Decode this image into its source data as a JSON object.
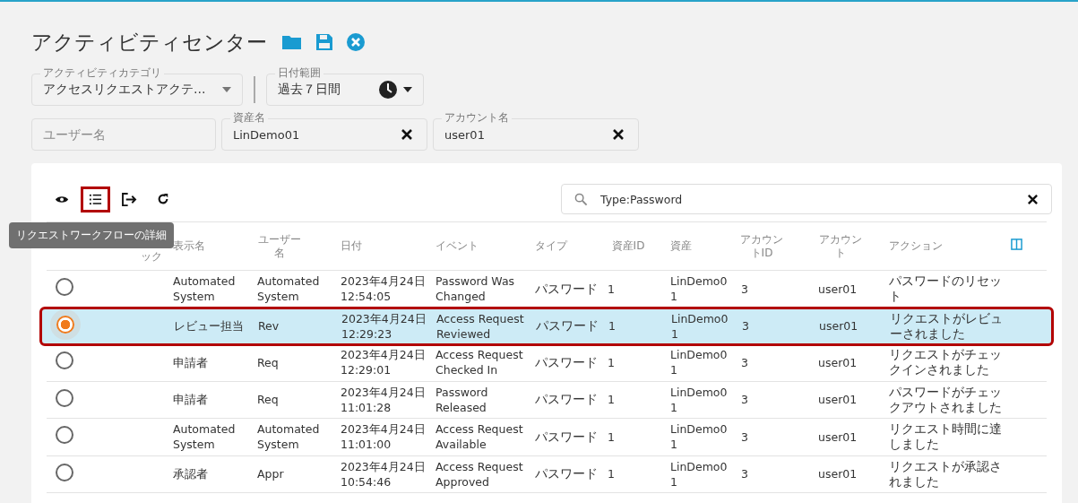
{
  "title": "アクティビティセンター",
  "filters": [
    {
      "kind": "select",
      "label": "アクティビティカテゴリ",
      "value": "アクセスリクエストアクテ…"
    },
    {
      "kind": "date",
      "label": "日付範囲",
      "value": "過去７日間"
    }
  ],
  "fields": [
    {
      "placeholder": "ユーザー名"
    },
    {
      "label": "資産名",
      "value": "LinDemo01"
    },
    {
      "label": "アカウント名",
      "value": "user01"
    }
  ],
  "toolbar": [
    {
      "kind": "eye",
      "highlighted": false
    },
    {
      "kind": "list",
      "highlighted": true
    },
    {
      "kind": "export",
      "highlighted": false
    },
    {
      "kind": "refresh",
      "highlighted": false
    }
  ],
  "tooltip": "リクエストワークフローの詳細",
  "search": {
    "value": "Type:Password"
  },
  "table": {
    "columns": [
      "ック",
      "表示名",
      "ユーザー名",
      "日付",
      "イベント",
      "タイプ",
      "資産ID",
      "資産",
      "アカウントID",
      "アカウント",
      "アクション"
    ],
    "rows": [
      {
        "selected": false,
        "highlighted": false,
        "cells": [
          "",
          "Automated System",
          "Automated System",
          "2023年4月24日 12:54:05",
          "Password Was Changed",
          "パスワード",
          "1",
          "LinDemo01",
          "3",
          "user01",
          "パスワードのリセット"
        ]
      },
      {
        "selected": true,
        "highlighted": true,
        "cells": [
          "",
          "レビュー担当",
          "Rev",
          "2023年4月24日 12:29:23",
          "Access Request Reviewed",
          "パスワード",
          "1",
          "LinDemo01",
          "3",
          "user01",
          "リクエストがレビューされました"
        ]
      },
      {
        "selected": false,
        "highlighted": false,
        "cells": [
          "",
          "申請者",
          "Req",
          "2023年4月24日 12:29:01",
          "Access Request Checked In",
          "パスワード",
          "1",
          "LinDemo01",
          "3",
          "user01",
          "リクエストがチェックインされました"
        ]
      },
      {
        "selected": false,
        "highlighted": false,
        "cells": [
          "",
          "申請者",
          "Req",
          "2023年4月24日 11:01:28",
          "Password Released",
          "パスワード",
          "1",
          "LinDemo01",
          "3",
          "user01",
          "パスワードがチェックアウトされました"
        ]
      },
      {
        "selected": false,
        "highlighted": false,
        "cells": [
          "",
          "Automated System",
          "Automated System",
          "2023年4月24日 11:01:00",
          "Access Request Available",
          "パスワード",
          "1",
          "LinDemo01",
          "3",
          "user01",
          "リクエスト時間に達しました"
        ]
      },
      {
        "selected": false,
        "highlighted": false,
        "cells": [
          "",
          "承認者",
          "Appr",
          "2023年4月24日 10:54:46",
          "Access Request Approved",
          "パスワード",
          "1",
          "LinDemo01",
          "3",
          "user01",
          "リクエストが承認されました"
        ]
      }
    ]
  }
}
